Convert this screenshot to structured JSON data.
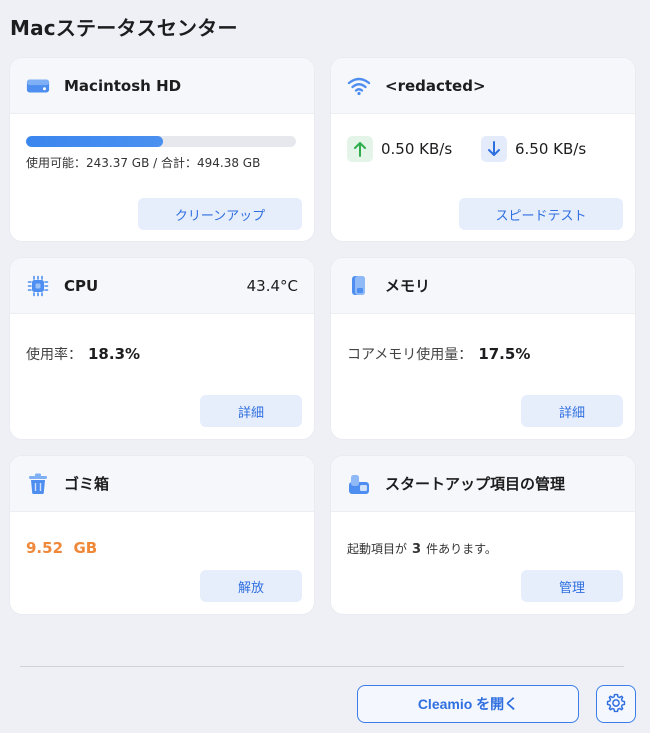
{
  "app": {
    "title": "Macステータスセンター"
  },
  "disk": {
    "title": "Macintosh HD",
    "usage_text": "使用可能：243.37 GB / 合計：494.38 GB",
    "used_fraction": 0.507,
    "button": "クリーンアップ"
  },
  "network": {
    "title": "<redacted>",
    "upload": "0.50 KB/s",
    "download": "6.50 KB/s",
    "button": "スピードテスト"
  },
  "cpu": {
    "title": "CPU",
    "temperature": "43.4°C",
    "usage_label": "使用率：",
    "usage_value": "18.3%",
    "button": "詳細"
  },
  "memory": {
    "title": "メモリ",
    "usage_label": "コアメモリ使用量：",
    "usage_value": "17.5%",
    "button": "詳細"
  },
  "trash": {
    "title": "ゴミ箱",
    "size": "9.52  GB",
    "button": "解放"
  },
  "startup": {
    "title": "スタートアップ項目の管理",
    "text_before": "起動項目が",
    "count": "3",
    "text_after": "件あります。",
    "button": "管理"
  },
  "footer": {
    "open_button": "Cleamio を開く",
    "settings_icon": "gear-icon"
  },
  "colors": {
    "accent": "#2f6fe0",
    "trash_size": "#f0883a",
    "upload_arrow": "#2fae4e",
    "download_arrow": "#2f6fe0"
  }
}
